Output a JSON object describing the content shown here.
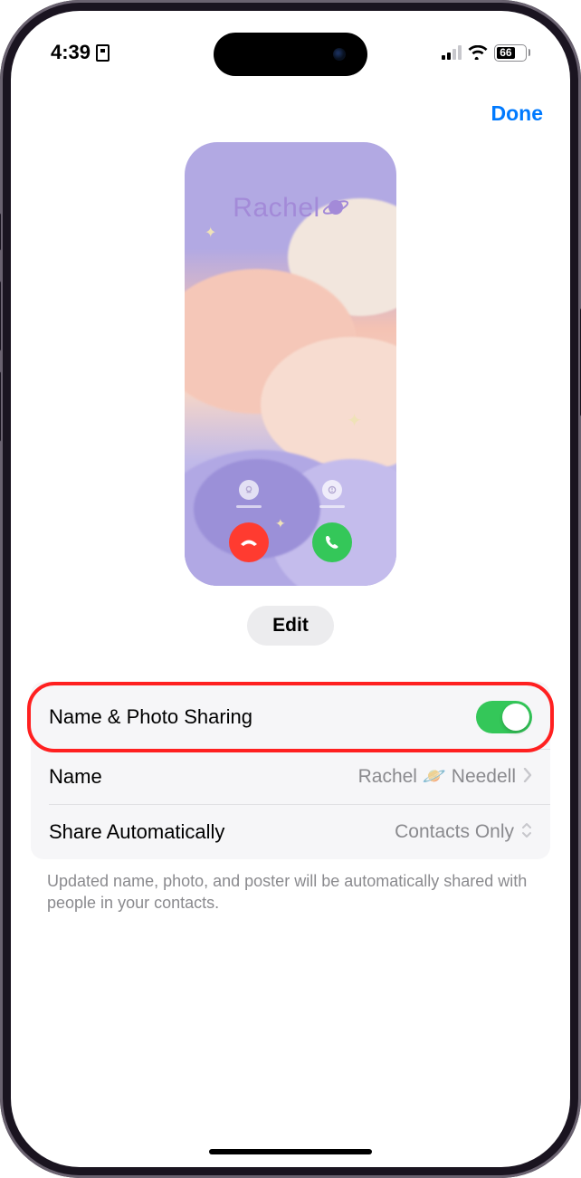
{
  "status": {
    "time": "4:39",
    "battery_pct": "66"
  },
  "nav": {
    "done": "Done"
  },
  "poster": {
    "name": "Rachel"
  },
  "edit_label": "Edit",
  "settings": {
    "sharing_row": {
      "label": "Name & Photo Sharing"
    },
    "name_row": {
      "label": "Name",
      "value": "Rachel 🪐 Needell"
    },
    "share_row": {
      "label": "Share Automatically",
      "value": "Contacts Only"
    }
  },
  "footer": "Updated name, photo, and poster will be automatically shared with people in your contacts."
}
